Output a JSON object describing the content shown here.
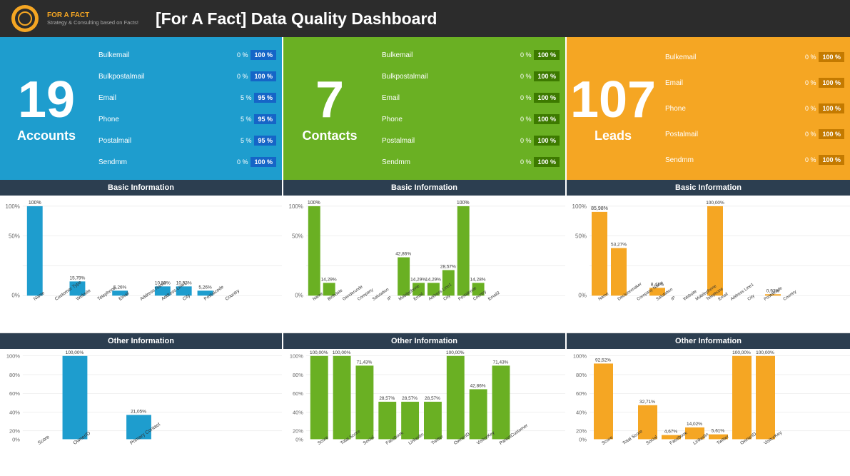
{
  "header": {
    "title": "[For A Fact] Data Quality Dashboard",
    "logo_text": "FOR A FACT\nStrategy & Consulting based on Facts!"
  },
  "sections": [
    {
      "id": "accounts",
      "color": "blue",
      "big_number": "19",
      "big_label": "Accounts",
      "stats": [
        {
          "label": "Bulkemail",
          "pct": "0 %",
          "bar": "100 %"
        },
        {
          "label": "Bulkpostalmail",
          "pct": "0 %",
          "bar": "100 %"
        },
        {
          "label": "Email",
          "pct": "5 %",
          "bar": "95 %"
        },
        {
          "label": "Phone",
          "pct": "5 %",
          "bar": "95 %"
        },
        {
          "label": "Postalmail",
          "pct": "5 %",
          "bar": "95 %"
        },
        {
          "label": "Sendmm",
          "pct": "0 %",
          "bar": "100 %"
        }
      ],
      "basic_label": "Basic Information",
      "basic_bars": [
        {
          "label": "Name",
          "value": 100,
          "display": "100%"
        },
        {
          "label": "Customer Type",
          "value": 0,
          "display": ""
        },
        {
          "label": "Website",
          "value": 15.79,
          "display": "15,79%"
        },
        {
          "label": "Telephone",
          "value": 0,
          "display": ""
        },
        {
          "label": "Email",
          "value": 5.26,
          "display": "5,26%"
        },
        {
          "label": "Address Name",
          "value": 0,
          "display": ""
        },
        {
          "label": "Address Line1",
          "value": 10.53,
          "display": "10,53%"
        },
        {
          "label": "City",
          "value": 10.53,
          "display": "10,53%"
        },
        {
          "label": "Postalcode",
          "value": 5.26,
          "display": "5,26%"
        },
        {
          "label": "Country",
          "value": 0,
          "display": ""
        }
      ],
      "other_label": "Other Information",
      "other_bars": [
        {
          "label": "Score",
          "value": 0,
          "display": ""
        },
        {
          "label": "OwnerID",
          "value": 100,
          "display": "100,00%"
        },
        {
          "label": "Primary Contact",
          "value": 21.05,
          "display": "21,05%"
        }
      ]
    },
    {
      "id": "contacts",
      "color": "green",
      "big_number": "7",
      "big_label": "Contacts",
      "stats": [
        {
          "label": "Bulkemail",
          "pct": "0 %",
          "bar": "100 %"
        },
        {
          "label": "Bulkpostalmail",
          "pct": "0 %",
          "bar": "100 %"
        },
        {
          "label": "Email",
          "pct": "0 %",
          "bar": "100 %"
        },
        {
          "label": "Phone",
          "pct": "0 %",
          "bar": "100 %"
        },
        {
          "label": "Postalmail",
          "pct": "0 %",
          "bar": "100 %"
        },
        {
          "label": "Sendmm",
          "pct": "0 %",
          "bar": "100 %"
        }
      ],
      "basic_label": "Basic Information",
      "basic_bars": [
        {
          "label": "Name",
          "value": 100,
          "display": "100%"
        },
        {
          "label": "Birthdate",
          "value": 14.29,
          "display": "14,29%"
        },
        {
          "label": "Gendercode",
          "value": 0,
          "display": ""
        },
        {
          "label": "Company",
          "value": 0,
          "display": ""
        },
        {
          "label": "Salutation",
          "value": 0,
          "display": ""
        },
        {
          "label": "IP",
          "value": 0,
          "display": ""
        },
        {
          "label": "Mobilephone",
          "value": 0,
          "display": ""
        },
        {
          "label": "Email",
          "value": 42.86,
          "display": "42,86%"
        },
        {
          "label": "Address Line1",
          "value": 14.29,
          "display": "14,29%"
        },
        {
          "label": "City",
          "value": 14.29,
          "display": "14,29%"
        },
        {
          "label": "Postalcode",
          "value": 28.57,
          "display": "28,57%"
        },
        {
          "label": "Country",
          "value": 100,
          "display": "100%"
        },
        {
          "label": "Email2",
          "value": 14.28,
          "display": "14,28%"
        }
      ],
      "other_label": "Other Information",
      "other_bars": [
        {
          "label": "Score",
          "value": 100,
          "display": "100,00%"
        },
        {
          "label": "Total Score",
          "value": 100,
          "display": "100,00%"
        },
        {
          "label": "Social",
          "value": 71.43,
          "display": "71,43%"
        },
        {
          "label": "Facebook",
          "value": 28.57,
          "display": "28,57%"
        },
        {
          "label": "LinkedIn",
          "value": 28.57,
          "display": "28,57%"
        },
        {
          "label": "Twitter",
          "value": 28.57,
          "display": "28,57%"
        },
        {
          "label": "OwnerID",
          "value": 100,
          "display": "100,00%"
        },
        {
          "label": "VisitorKey",
          "value": 42.86,
          "display": "42,86%"
        },
        {
          "label": "ParentCustomer",
          "value": 71.43,
          "display": "71,43%"
        }
      ]
    },
    {
      "id": "leads",
      "color": "orange",
      "big_number": "107",
      "big_label": "Leads",
      "stats": [
        {
          "label": "Bulkemail",
          "pct": "0 %",
          "bar": "100 %"
        },
        {
          "label": "Email",
          "pct": "0 %",
          "bar": "100 %"
        },
        {
          "label": "Phone",
          "pct": "0 %",
          "bar": "100 %"
        },
        {
          "label": "Postalmail",
          "pct": "0 %",
          "bar": "100 %"
        },
        {
          "label": "Sendmm",
          "pct": "0 %",
          "bar": "100 %"
        }
      ],
      "basic_label": "Basic Information",
      "basic_bars": [
        {
          "label": "Name",
          "value": 85.98,
          "display": "85,98%"
        },
        {
          "label": "Decisionmaker",
          "value": 53.27,
          "display": "53,27%"
        },
        {
          "label": "Company Name",
          "value": 0,
          "display": ""
        },
        {
          "label": "Salutation",
          "value": 0,
          "display": ""
        },
        {
          "label": "IP",
          "value": 8.41,
          "display": "8,41%"
        },
        {
          "label": "Website",
          "value": 0,
          "display": ""
        },
        {
          "label": "Mobilephone",
          "value": 0,
          "display": ""
        },
        {
          "label": "Telephone",
          "value": 0,
          "display": ""
        },
        {
          "label": "Email",
          "value": 100,
          "display": "100,00%"
        },
        {
          "label": "Address Line1",
          "value": 0,
          "display": ""
        },
        {
          "label": "City",
          "value": 0,
          "display": ""
        },
        {
          "label": "Postalcode",
          "value": 0.93,
          "display": "0,93%"
        },
        {
          "label": "Country",
          "value": 0,
          "display": ""
        }
      ],
      "other_label": "Other Information",
      "other_bars": [
        {
          "label": "Score",
          "value": 92.52,
          "display": "92,52%"
        },
        {
          "label": "Total Score",
          "value": 0,
          "display": ""
        },
        {
          "label": "Social",
          "value": 32.71,
          "display": "32,71%"
        },
        {
          "label": "Facebook",
          "value": 4.67,
          "display": "4,67%"
        },
        {
          "label": "LinkedIn",
          "value": 14.02,
          "display": "14,02%"
        },
        {
          "label": "Twitter",
          "value": 5.61,
          "display": "5,61%"
        },
        {
          "label": "OwnerID",
          "value": 100,
          "display": "100,00%"
        },
        {
          "label": "VisitorKey",
          "value": 100,
          "display": "100,00%"
        }
      ]
    }
  ]
}
